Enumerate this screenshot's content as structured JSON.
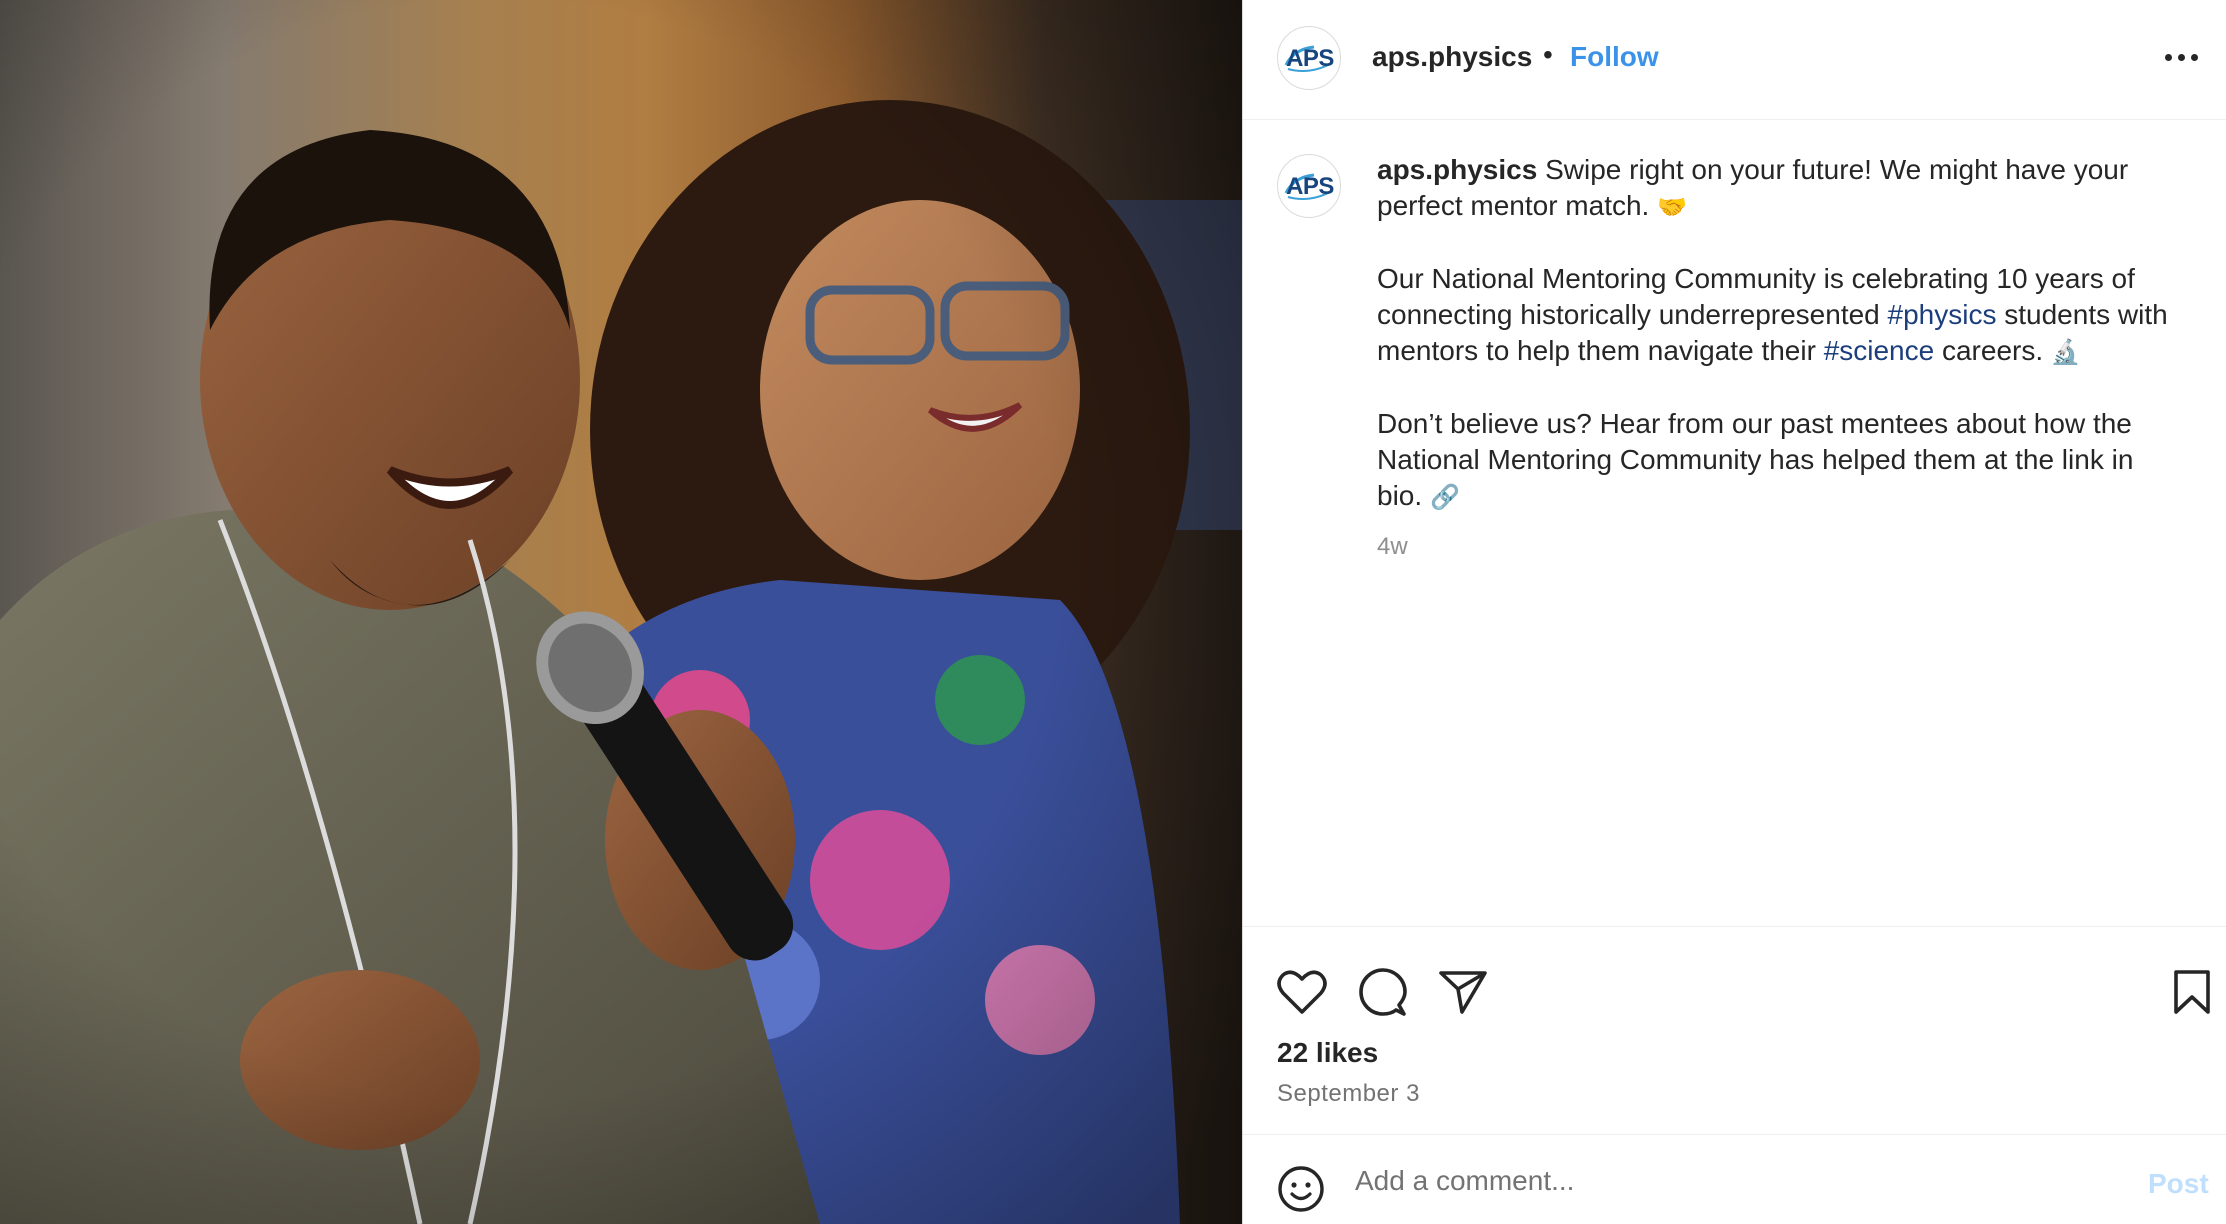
{
  "post": {
    "username": "aps.physics",
    "avatar_text": "APS",
    "separator": "•",
    "follow_label": "Follow",
    "more_icon": "more-horizontal-icon"
  },
  "caption": {
    "username": "aps.physics",
    "p1_text": " Swipe right on your future! We might have your perfect mentor match. ",
    "p1_emoji": "🤝",
    "p2_a": "Our National Mentoring Community is celebrating 10 years of connecting historically underrepresented ",
    "p2_tag1": "#physics",
    "p2_b": " students with mentors to help them navigate their ",
    "p2_tag2": "#science",
    "p2_c": " careers. ",
    "p2_emoji": "🔬",
    "p3_text": "Don’t believe us? Hear from our past mentees about how the National Mentoring Community has helped them at the link in bio. ",
    "p3_emoji": "🔗",
    "age": "4w"
  },
  "actions": {
    "icons": [
      "heart-icon",
      "comment-icon",
      "share-icon",
      "bookmark-icon"
    ],
    "likes": "22 likes",
    "date": "September 3"
  },
  "comment_box": {
    "placeholder": "Add a comment...",
    "post_label": "Post",
    "emoji_icon": "smiley-icon"
  },
  "colors": {
    "follow": "#3a93e8",
    "hashtag": "#1d3e7c",
    "post_disabled": "#c0dffd",
    "brand_logo": "#17457d"
  }
}
